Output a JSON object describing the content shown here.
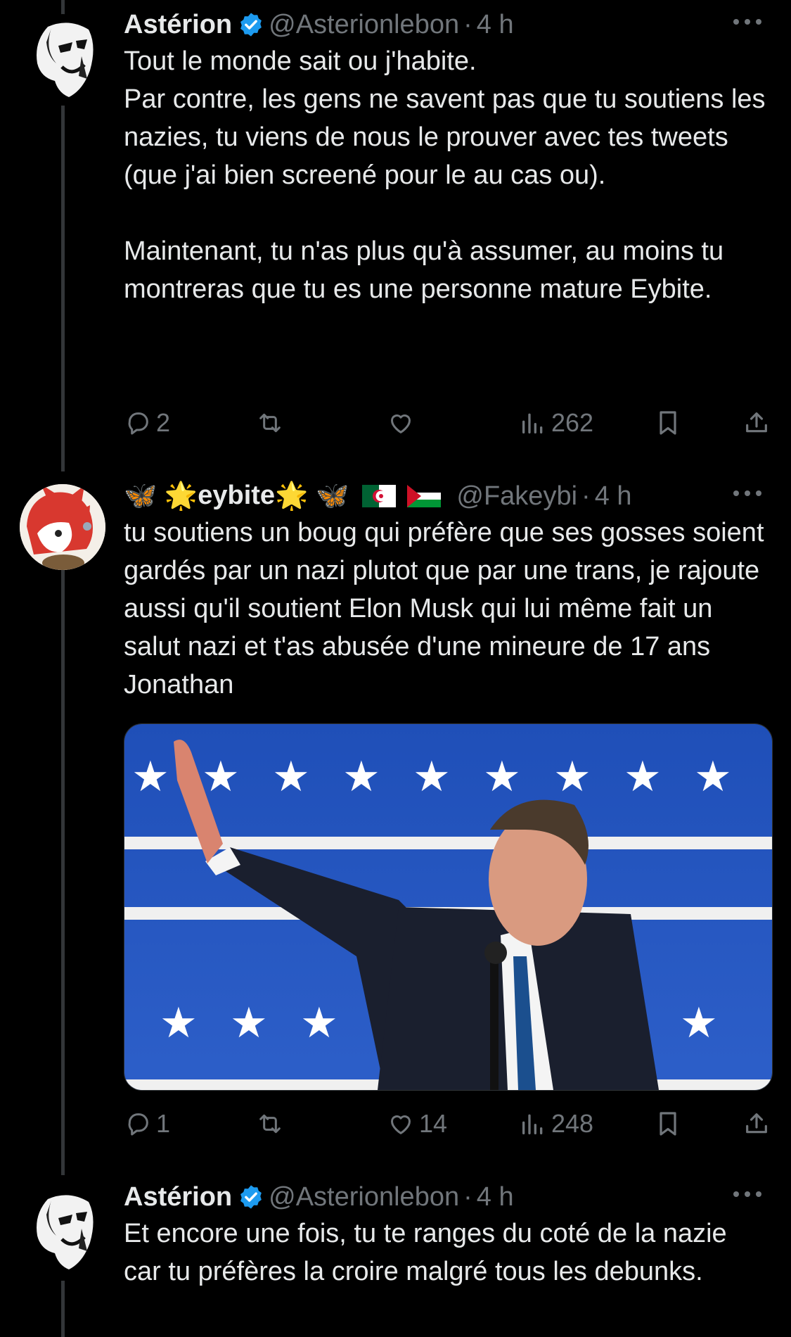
{
  "tweets": [
    {
      "name": "Astérion",
      "handle": "@Asterionlebon",
      "time": "4 h",
      "text": "Tout le monde sait ou j'habite.\nPar contre, les gens ne savent pas que tu soutiens les nazies, tu viens de nous le prouver avec tes tweets (que j'ai bien screené pour le au cas ou).\n\nMaintenant, tu n'as plus qu'à assumer, au moins tu montreras que tu es une personne mature Eybite.",
      "replies": "2",
      "retweets": "",
      "likes": "",
      "views": "262"
    },
    {
      "name": "eybite",
      "name_decor": "🦋 🌟eybite🌟 🦋 🇩🇿 🇵🇸",
      "handle": "@Fakeybi",
      "time": "4 h",
      "text": "tu soutiens un boug qui préfère que ses gosses soient gardés par un nazi plutot que par une trans, je rajoute aussi qu'il soutient Elon Musk qui lui même fait un salut nazi et t'as abusée d'une mineure de 17 ans Jonathan",
      "replies": "1",
      "retweets": "",
      "likes": "14",
      "views": "248"
    },
    {
      "name": "Astérion",
      "handle": "@Asterionlebon",
      "time": "4 h",
      "text": "Et encore une fois, tu te ranges du coté de la nazie car tu préfères la croire malgré tous les debunks."
    }
  ],
  "colors": {
    "background": "#000000",
    "text": "#e7e9ea",
    "muted": "#71767b",
    "verified": "#1d9bf0",
    "thread_line": "#333639"
  },
  "icons": [
    "verified-badge-icon",
    "more-icon",
    "reply-icon",
    "retweet-icon",
    "like-icon",
    "views-icon",
    "bookmark-icon",
    "share-icon"
  ]
}
